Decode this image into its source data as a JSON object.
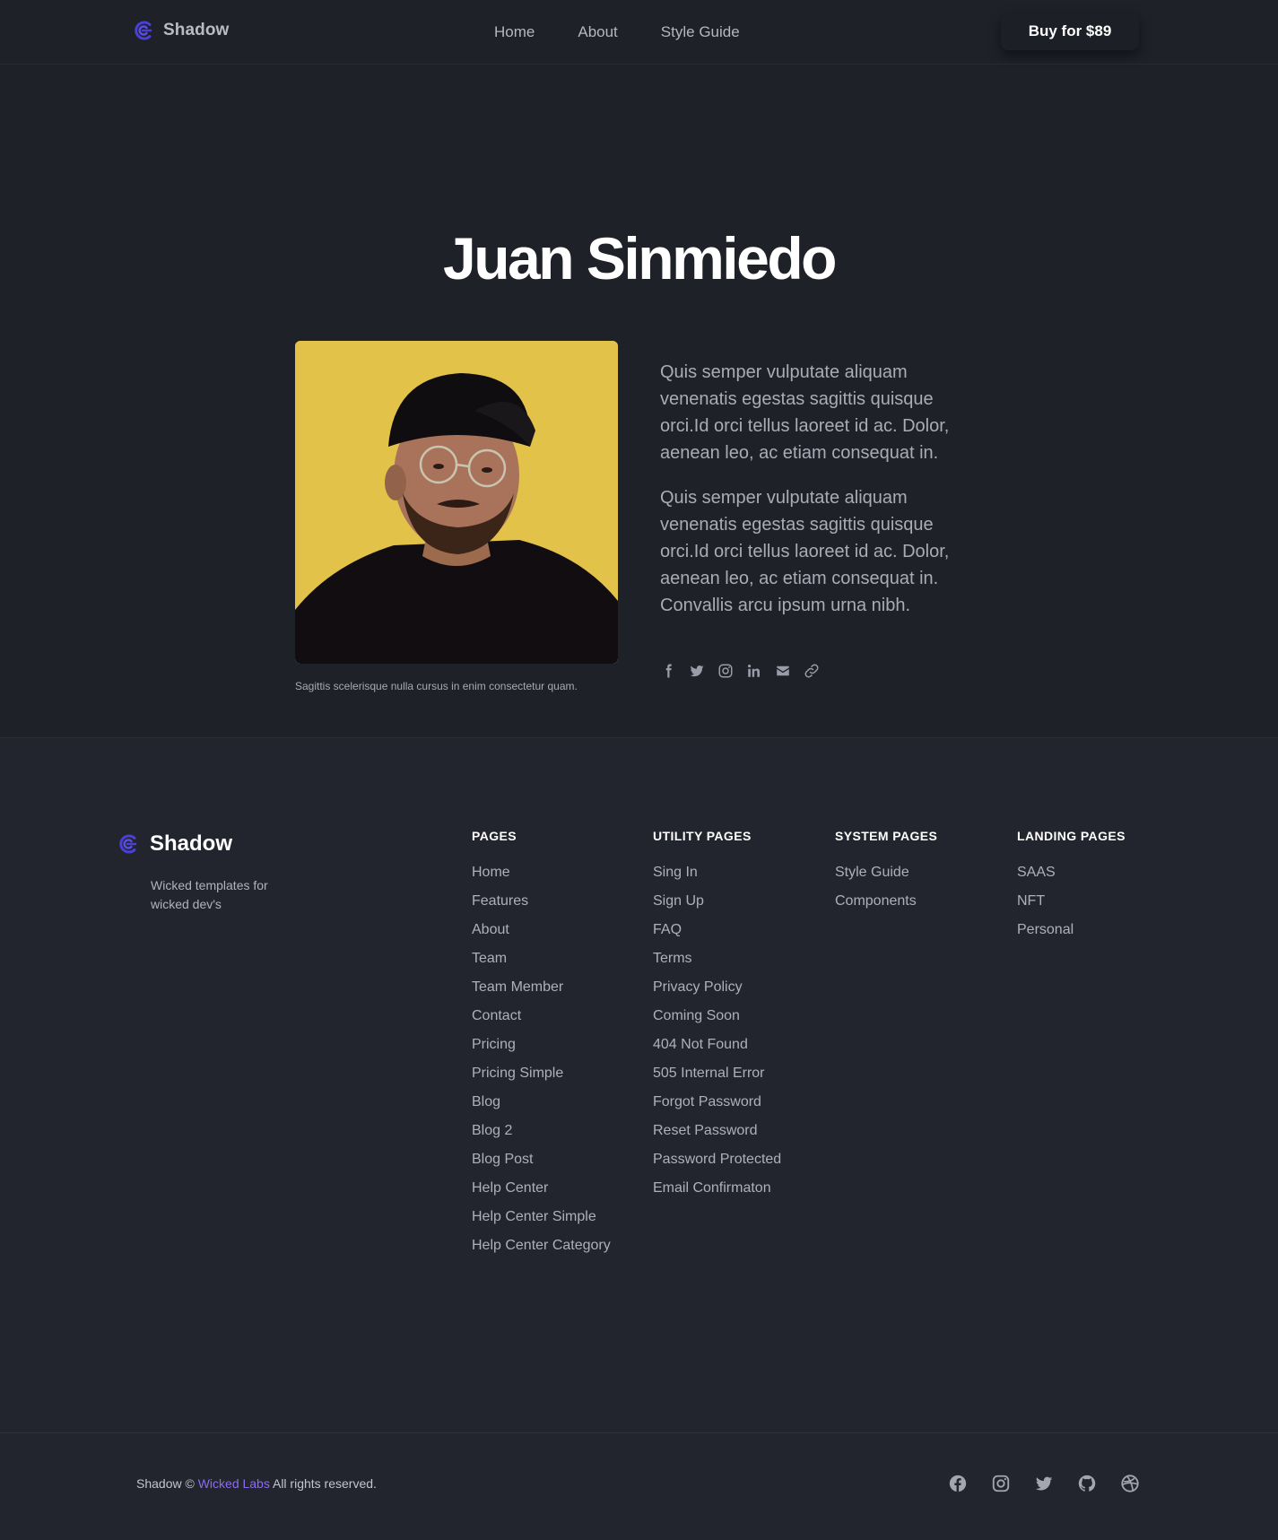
{
  "header": {
    "brand": "Shadow",
    "nav": [
      "Home",
      "About",
      "Style Guide"
    ],
    "buy_button": "Buy for $89"
  },
  "member": {
    "name": "Juan Sinmiedo",
    "photo_caption": "Sagittis scelerisque nulla cursus in enim consectetur quam.",
    "bio": [
      "Quis semper vulputate aliquam venenatis egestas sagittis quisque orci.Id orci tellus laoreet id ac. Dolor, aenean leo, ac etiam consequat in.",
      "Quis semper vulputate aliquam venenatis egestas sagittis quisque orci.Id orci tellus laoreet id ac. Dolor, aenean leo, ac etiam consequat in. Convallis arcu ipsum urna nibh."
    ],
    "social_icons": [
      "facebook-icon",
      "twitter-icon",
      "instagram-icon",
      "linkedin-icon",
      "email-icon",
      "link-icon"
    ]
  },
  "footer": {
    "brand": "Shadow",
    "tagline": "Wicked templates for wicked dev's",
    "columns": [
      {
        "title": "PAGES",
        "links": [
          "Home",
          "Features",
          "About",
          "Team",
          "Team Member",
          "Contact",
          "Pricing",
          "Pricing Simple",
          "Blog",
          "Blog 2",
          "Blog Post",
          "Help Center",
          "Help Center Simple",
          "Help Center Category"
        ]
      },
      {
        "title": "UTILITY PAGES",
        "links": [
          "Sing In",
          "Sign Up",
          "FAQ",
          "Terms",
          "Privacy Policy",
          "Coming Soon",
          "404 Not Found",
          "505 Internal Error",
          "Forgot Password",
          "Reset Password",
          "Password Protected",
          "Email Confirmaton"
        ]
      },
      {
        "title": "SYSTEM PAGES",
        "links": [
          "Style Guide",
          "Components"
        ]
      },
      {
        "title": "LANDING PAGES",
        "links": [
          "SAAS",
          "NFT",
          "Personal"
        ]
      }
    ],
    "copyright_prefix": "Shadow ©",
    "copyright_link": "Wicked Labs",
    "copyright_suffix": "All rights reserved.",
    "social_icons": [
      "facebook-icon",
      "instagram-icon",
      "twitter-icon",
      "github-icon",
      "dribbble-icon"
    ]
  },
  "colors": {
    "background": "#1f2129",
    "footer_background": "#23252e",
    "accent": "#8a6cf0",
    "logo": "#4b3fd6",
    "photo_background": "#e3c24a"
  }
}
